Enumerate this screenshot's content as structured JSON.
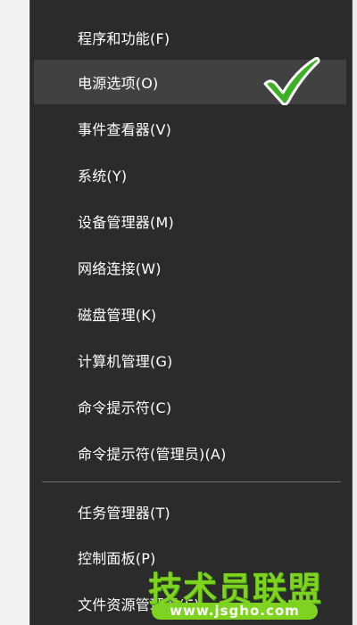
{
  "menu": {
    "items": [
      {
        "label": "程序和功能(F)"
      },
      {
        "label": "电源选项(O)"
      },
      {
        "label": "事件查看器(V)"
      },
      {
        "label": "系统(Y)"
      },
      {
        "label": "设备管理器(M)"
      },
      {
        "label": "网络连接(W)"
      },
      {
        "label": "磁盘管理(K)"
      },
      {
        "label": "计算机管理(G)"
      },
      {
        "label": "命令提示符(C)"
      },
      {
        "label": "命令提示符(管理员)(A)"
      },
      {
        "label": "任务管理器(T)"
      },
      {
        "label": "控制面板(P)"
      },
      {
        "label": "文件资源管理器(E)"
      }
    ],
    "selected_label": "电源选项(O)"
  },
  "annotation": {
    "icon": "checkmark-icon",
    "color": "#3cb023"
  },
  "watermark": {
    "title": "技术员联盟",
    "url": "www.jsgho.com",
    "color": "#7ed321"
  },
  "colors": {
    "menu_background": "#2b2b2b",
    "menu_text": "#ffffff",
    "selected_background": "#414141",
    "separator": "#6b6b6b"
  }
}
